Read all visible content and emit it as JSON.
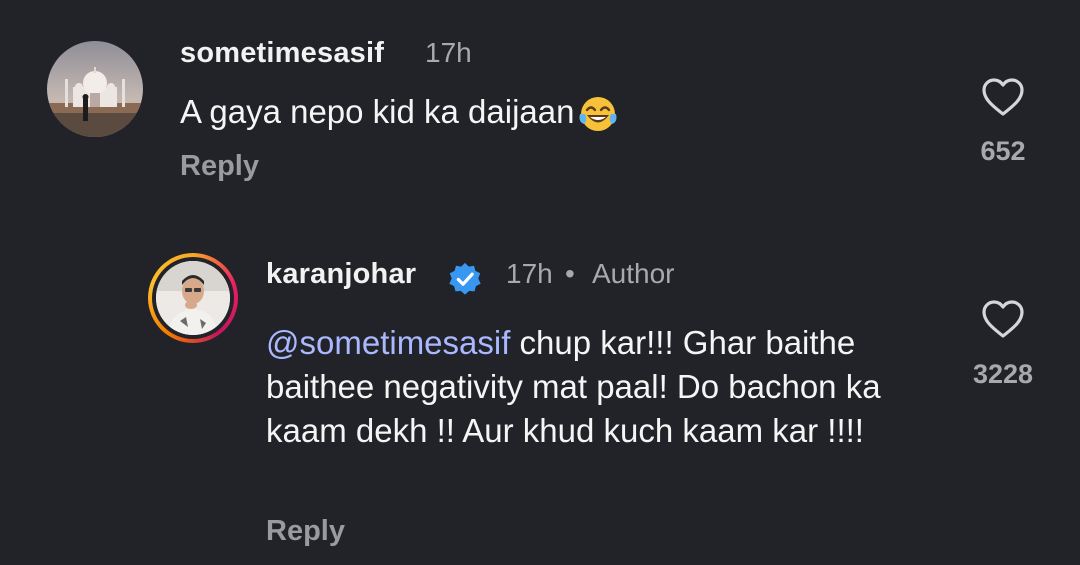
{
  "comments": [
    {
      "username": "sometimesasif",
      "time": "17h",
      "text": "A gaya nepo kid ka daijaan",
      "emoji": "face-with-tears-of-joy",
      "reply_label": "Reply",
      "likes": "652",
      "avatar": "taj-mahal-photo"
    },
    {
      "username": "karanjohar",
      "verified": true,
      "time": "17h",
      "separator": "•",
      "author_label": "Author",
      "mention": "@sometimesasif",
      "text": " chup kar!!! Ghar baithe baithee negativity mat paal! Do bachon ka kaam dekh !! Aur khud kuch kaam kar !!!!",
      "reply_label": "Reply",
      "likes": "3228",
      "avatar": "profile-photo-man"
    }
  ],
  "colors": {
    "background": "#212328",
    "text": "#f5f5f5",
    "muted": "#a8a8ad",
    "mention": "#a9b8ff",
    "verified": "#3897f0"
  }
}
